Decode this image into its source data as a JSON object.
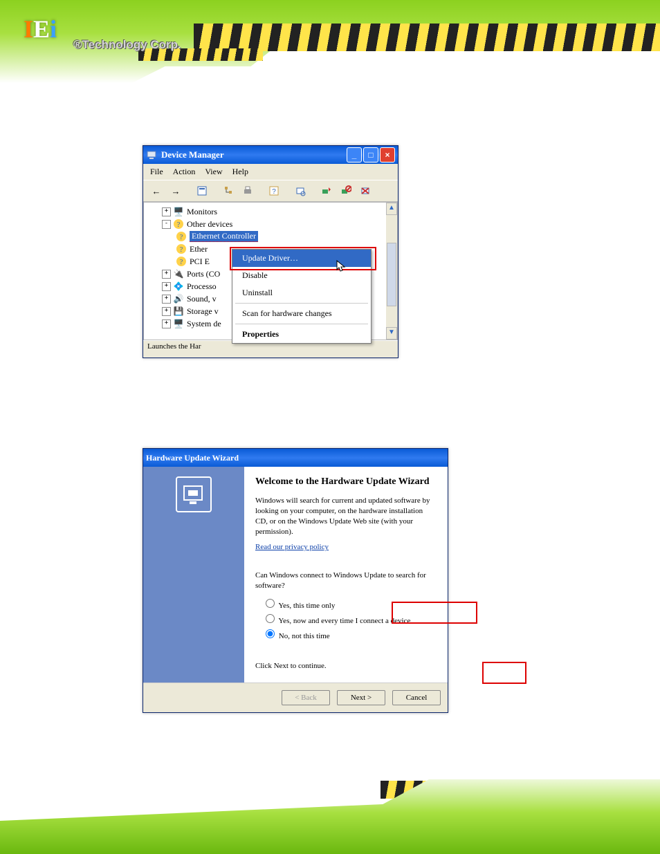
{
  "brand": {
    "logo_i1": "I",
    "logo_e": "E",
    "logo_i2": "i",
    "tech": "®Technology Corp."
  },
  "dm": {
    "title": "Device Manager",
    "menu": [
      "File",
      "Action",
      "View",
      "Help"
    ],
    "tree": {
      "monitors": "Monitors",
      "other": "Other devices",
      "eth1": "Ethernet Controller",
      "eth2": "Ether",
      "pci": "PCI E",
      "ports": "Ports (CO",
      "proc": "Processo",
      "sound": "Sound, v",
      "storage": "Storage v",
      "system": "System de"
    },
    "status": "Launches the Har",
    "ctx": {
      "update": "Update Driver…",
      "disable": "Disable",
      "uninstall": "Uninstall",
      "scan": "Scan for hardware changes",
      "props": "Properties"
    }
  },
  "wiz": {
    "title": "Hardware Update Wizard",
    "heading": "Welcome to the Hardware Update Wizard",
    "intro": "Windows will search for current and updated software by looking on your computer, on the hardware installation CD, or on the Windows Update Web site (with your permission).",
    "privacy": "Read our privacy policy",
    "question": "Can Windows connect to Windows Update to search for software?",
    "opt1": "Yes, this time only",
    "opt2": "Yes, now and every time I connect a device",
    "opt3": "No, not this time",
    "cont": "Click Next to continue.",
    "back": "< Back",
    "next": "Next >",
    "cancel": "Cancel"
  }
}
